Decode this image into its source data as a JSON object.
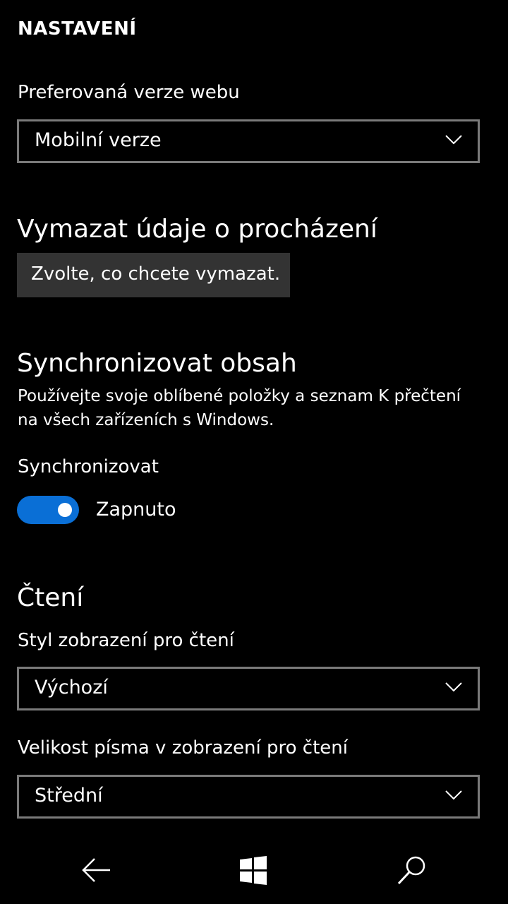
{
  "page": {
    "title": "NASTAVENÍ"
  },
  "web_version": {
    "label": "Preferovaná verze webu",
    "value": "Mobilní verze"
  },
  "clear_data": {
    "heading": "Vymazat údaje o procházení",
    "button_label": "Zvolte, co chcete vymazat."
  },
  "sync": {
    "heading": "Synchronizovat obsah",
    "description": "Používejte svoje oblíbené položky a seznam K přečtení na všech zařízeních s Windows.",
    "toggle_label": "Synchronizovat",
    "toggle_state": "Zapnuto",
    "toggle_on": true
  },
  "reading": {
    "heading": "Čtení",
    "style_label": "Styl zobrazení pro čtení",
    "style_value": "Výchozí",
    "font_size_label": "Velikost písma v zobrazení pro čtení",
    "font_size_value": "Střední"
  },
  "nav": {
    "back_icon": "back-arrow-icon",
    "start_icon": "windows-logo-icon",
    "search_icon": "search-icon"
  },
  "colors": {
    "background": "#000000",
    "accent": "#0a6fd6",
    "dropdown_border": "#7a7a7a",
    "button_bg": "#333333"
  }
}
